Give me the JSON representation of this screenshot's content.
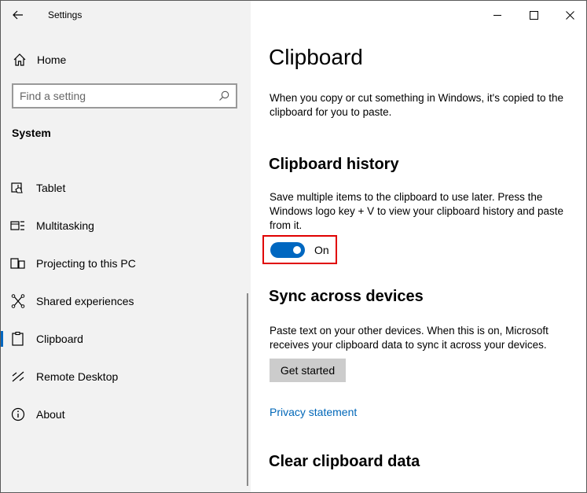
{
  "app": {
    "title": "Settings"
  },
  "nav": {
    "home_label": "Home",
    "search_placeholder": "Find a setting",
    "section_label": "System",
    "items": [
      {
        "label": "Tablet",
        "icon": "tablet-icon"
      },
      {
        "label": "Multitasking",
        "icon": "multitasking-icon"
      },
      {
        "label": "Projecting to this PC",
        "icon": "projecting-icon"
      },
      {
        "label": "Shared experiences",
        "icon": "shared-experiences-icon"
      },
      {
        "label": "Clipboard",
        "icon": "clipboard-icon",
        "active": true
      },
      {
        "label": "Remote Desktop",
        "icon": "remote-desktop-icon"
      },
      {
        "label": "About",
        "icon": "info-icon"
      }
    ]
  },
  "page": {
    "title": "Clipboard",
    "intro": "When you copy or cut something in Windows, it's copied to the clipboard for you to paste.",
    "history": {
      "heading": "Clipboard history",
      "description": "Save multiple items to the clipboard to use later. Press the Windows logo key + V to view your clipboard history and paste from it.",
      "toggle_state": "On"
    },
    "sync": {
      "heading": "Sync across devices",
      "description": "Paste text on your other devices. When this is on, Microsoft receives your clipboard data to sync it across your devices.",
      "button_label": "Get started",
      "privacy_link": "Privacy statement"
    },
    "clear": {
      "heading": "Clear clipboard data"
    }
  },
  "colors": {
    "accent": "#0067c0",
    "link": "#0067b8",
    "highlight": "#e00000"
  }
}
